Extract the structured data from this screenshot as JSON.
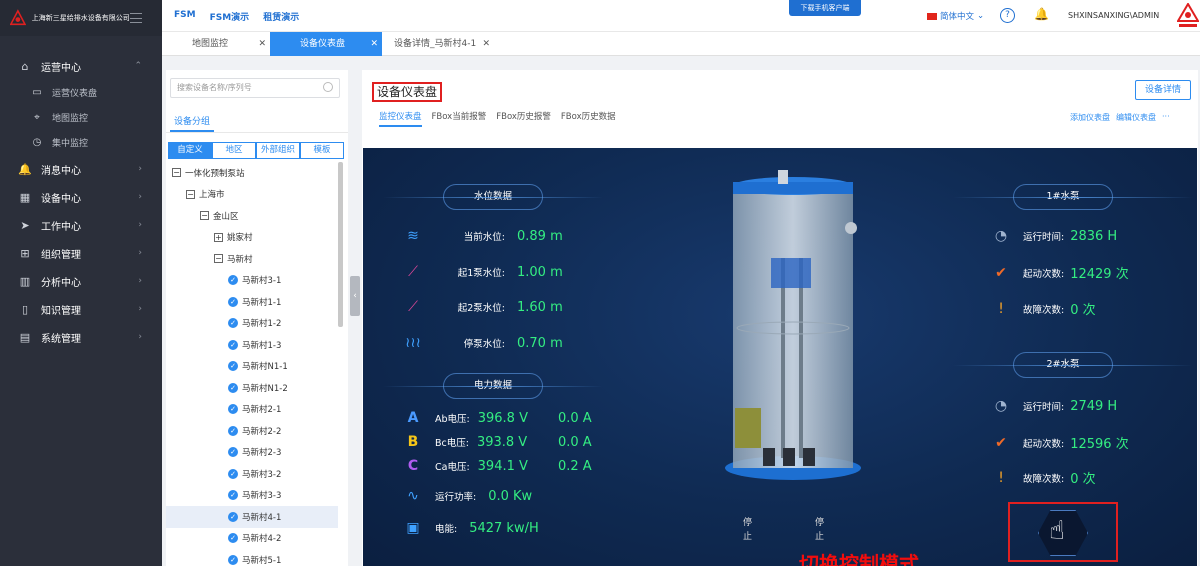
{
  "sidebar": {
    "company": "上海新三星给排水设备有限公司",
    "items": [
      {
        "label": "运营中心",
        "icon": "home-icon",
        "expanded": true
      },
      {
        "label": "运营仪表盘",
        "icon": "monitor-icon",
        "sub": true
      },
      {
        "label": "地图监控",
        "icon": "map-pin-icon",
        "sub": true
      },
      {
        "label": "集中监控",
        "icon": "clock-icon",
        "sub": true
      },
      {
        "label": "消息中心",
        "icon": "bell-icon"
      },
      {
        "label": "设备中心",
        "icon": "grid-icon"
      },
      {
        "label": "工作中心",
        "icon": "send-icon"
      },
      {
        "label": "组织管理",
        "icon": "org-icon"
      },
      {
        "label": "分析中心",
        "icon": "bar-chart-icon"
      },
      {
        "label": "知识管理",
        "icon": "book-icon"
      },
      {
        "label": "系统管理",
        "icon": "settings-box-icon"
      }
    ]
  },
  "header": {
    "menu": [
      "FSM",
      "FSM演示",
      "租赁演示"
    ],
    "download": "下载手机客户端",
    "language": "简体中文",
    "user": "SHXINSANXING\\ADMIN"
  },
  "tabs": [
    {
      "label": "地图监控",
      "active": false
    },
    {
      "label": "设备仪表盘",
      "active": true
    },
    {
      "label": "设备详情_马新村4-1",
      "active": false
    }
  ],
  "tree": {
    "search_placeholder": "搜索设备名称/序列号",
    "group_title": "设备分组",
    "filters": [
      "自定义",
      "地区",
      "外部组织",
      "模板"
    ],
    "nodes": [
      {
        "label": "一体化预制泵站",
        "level": 0,
        "type": "minus"
      },
      {
        "label": "上海市",
        "level": 1,
        "type": "minus"
      },
      {
        "label": "金山区",
        "level": 2,
        "type": "minus"
      },
      {
        "label": "姚家村",
        "level": 3,
        "type": "plus"
      },
      {
        "label": "马新村",
        "level": 3,
        "type": "minus"
      },
      {
        "label": "马新村3-1",
        "level": 4,
        "type": "check"
      },
      {
        "label": "马新村1-1",
        "level": 4,
        "type": "check"
      },
      {
        "label": "马新村1-2",
        "level": 4,
        "type": "check"
      },
      {
        "label": "马新村1-3",
        "level": 4,
        "type": "check"
      },
      {
        "label": "马新村N1-1",
        "level": 4,
        "type": "check"
      },
      {
        "label": "马新村N1-2",
        "level": 4,
        "type": "check"
      },
      {
        "label": "马新村2-1",
        "level": 4,
        "type": "check"
      },
      {
        "label": "马新村2-2",
        "level": 4,
        "type": "check"
      },
      {
        "label": "马新村2-3",
        "level": 4,
        "type": "check"
      },
      {
        "label": "马新村3-2",
        "level": 4,
        "type": "check"
      },
      {
        "label": "马新村3-3",
        "level": 4,
        "type": "check"
      },
      {
        "label": "马新村4-1",
        "level": 4,
        "type": "check",
        "selected": true
      },
      {
        "label": "马新村4-2",
        "level": 4,
        "type": "check"
      },
      {
        "label": "马新村5-1",
        "level": 4,
        "type": "check"
      }
    ]
  },
  "main": {
    "title": "设备仪表盘",
    "subtabs": [
      "监控仪表盘",
      "FBox当前报警",
      "FBox历史报警",
      "FBox历史数据"
    ],
    "detail_button": "设备详情",
    "links": [
      "添加仪表盘",
      "编辑仪表盘",
      "···"
    ]
  },
  "dashboard": {
    "water": {
      "title": "水位数据",
      "rows": [
        {
          "label": "当前水位:",
          "value": "0.89 m",
          "icon": "water-level-icon",
          "color": "#3fa1ff"
        },
        {
          "label": "起1泵水位:",
          "value": "1.00 m",
          "icon": "trend-up-icon",
          "color": "#e0489a"
        },
        {
          "label": "起2泵水位:",
          "value": "1.60 m",
          "icon": "trend-up-icon",
          "color": "#e0489a"
        },
        {
          "label": "停泵水位:",
          "value": "0.70 m",
          "icon": "waves-icon",
          "color": "#3fa1ff"
        }
      ]
    },
    "power": {
      "title": "电力数据",
      "rows": [
        {
          "label": "Ab电压:",
          "value": "396.8 V",
          "value2": "0.0 A",
          "icon": "A",
          "color": "#4a9aff"
        },
        {
          "label": "Bc电压:",
          "value": "393.8 V",
          "value2": "0.0 A",
          "icon": "B",
          "color": "#f5c518"
        },
        {
          "label": "Ca电压:",
          "value": "394.1 V",
          "value2": "0.2 A",
          "icon": "C",
          "color": "#b05cf0"
        }
      ],
      "run_power_label": "运行功率:",
      "run_power": "0.0 Kw",
      "energy_label": "电能:",
      "energy": "5427 kw/H"
    },
    "pump1": {
      "title": "1#水泵",
      "rows": [
        {
          "label": "运行时间:",
          "value": "2836 H",
          "icon": "clock-icon"
        },
        {
          "label": "起动次数:",
          "value": "12429 次",
          "icon": "check-icon"
        },
        {
          "label": "故障次数:",
          "value": "0 次",
          "icon": "alert-icon"
        }
      ]
    },
    "pump2": {
      "title": "2#水泵",
      "rows": [
        {
          "label": "运行时间:",
          "value": "2749 H",
          "icon": "clock-icon"
        },
        {
          "label": "起动次数:",
          "value": "12596 次",
          "icon": "check-icon"
        },
        {
          "label": "故障次数:",
          "value": "0 次",
          "icon": "alert-icon"
        }
      ]
    },
    "stop1": "停\n止",
    "stop2": "停\n止",
    "switch_mode": "切换控制模式"
  }
}
